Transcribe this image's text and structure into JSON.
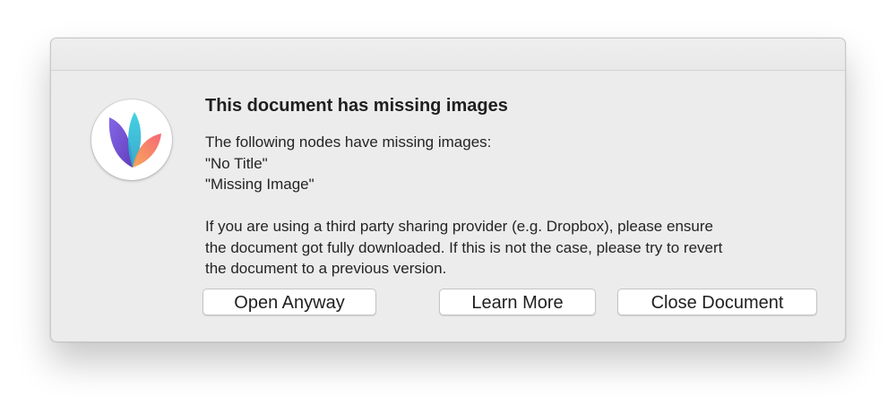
{
  "dialog": {
    "title": "This document has missing images",
    "message": {
      "line1": "The following nodes have missing images:",
      "line2": "\"No Title\"",
      "line3": "\"Missing Image\"",
      "line4": "If you are using a third party sharing provider (e.g. Dropbox), please ensure",
      "line5": "the document got fully downloaded. If this is not the case, please try to revert",
      "line6": "the document to a previous version."
    },
    "app_icon": "mindnode-leaf-icon",
    "buttons": {
      "open_anyway": "Open Anyway",
      "learn_more": "Learn More",
      "close_document": "Close Document"
    }
  },
  "colors": {
    "window_background": "#ececec",
    "leaf_purple": "#6a4bd0",
    "leaf_teal": "#2fc1d1",
    "leaf_orange": "#f2685a"
  }
}
